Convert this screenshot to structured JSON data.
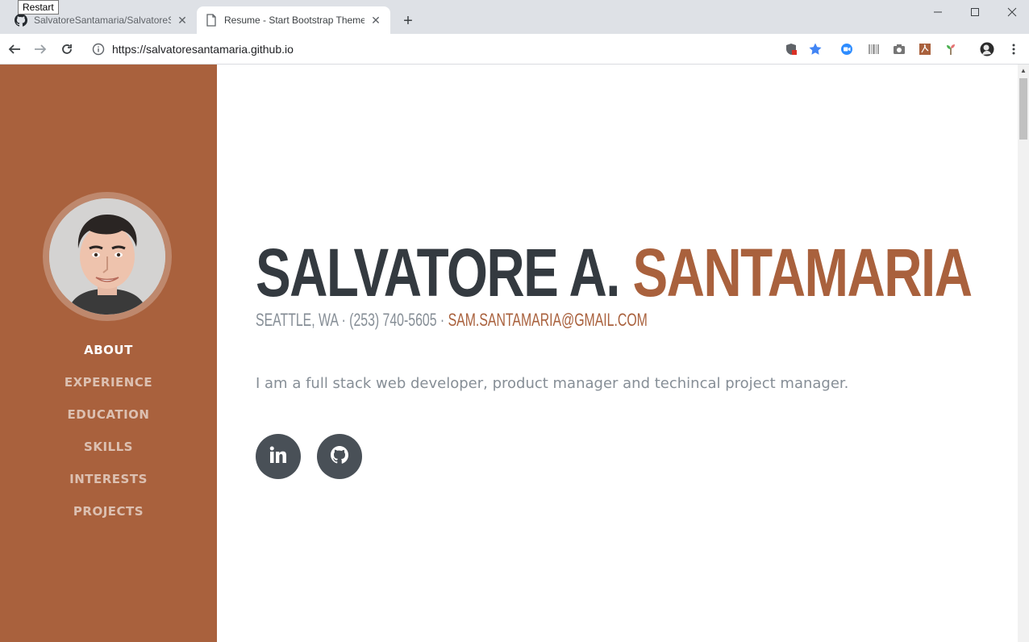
{
  "browser": {
    "tooltip": "Restart",
    "tabs": [
      {
        "title": "SalvatoreSantamaria/SalvatoreSa",
        "favicon": "github-icon"
      },
      {
        "title": "Resume - Start Bootstrap Theme",
        "favicon": "page-icon"
      }
    ],
    "url": "https://salvatoresantamaria.github.io"
  },
  "sidebar": {
    "color": "#a9613d",
    "nav": [
      "About",
      "Experience",
      "Education",
      "Skills",
      "Interests",
      "Projects"
    ]
  },
  "hero": {
    "first_name": "SALVATORE A.",
    "last_name": "SANTAMARIA",
    "location_phone": "SEATTLE, WA · (253) 740-5605 ·",
    "email": "SAM.SANTAMARIA@GMAIL.COM",
    "lead": "I am a full stack web developer, product manager and techincal project manager.",
    "social": [
      "linkedin-icon",
      "github-icon"
    ]
  }
}
